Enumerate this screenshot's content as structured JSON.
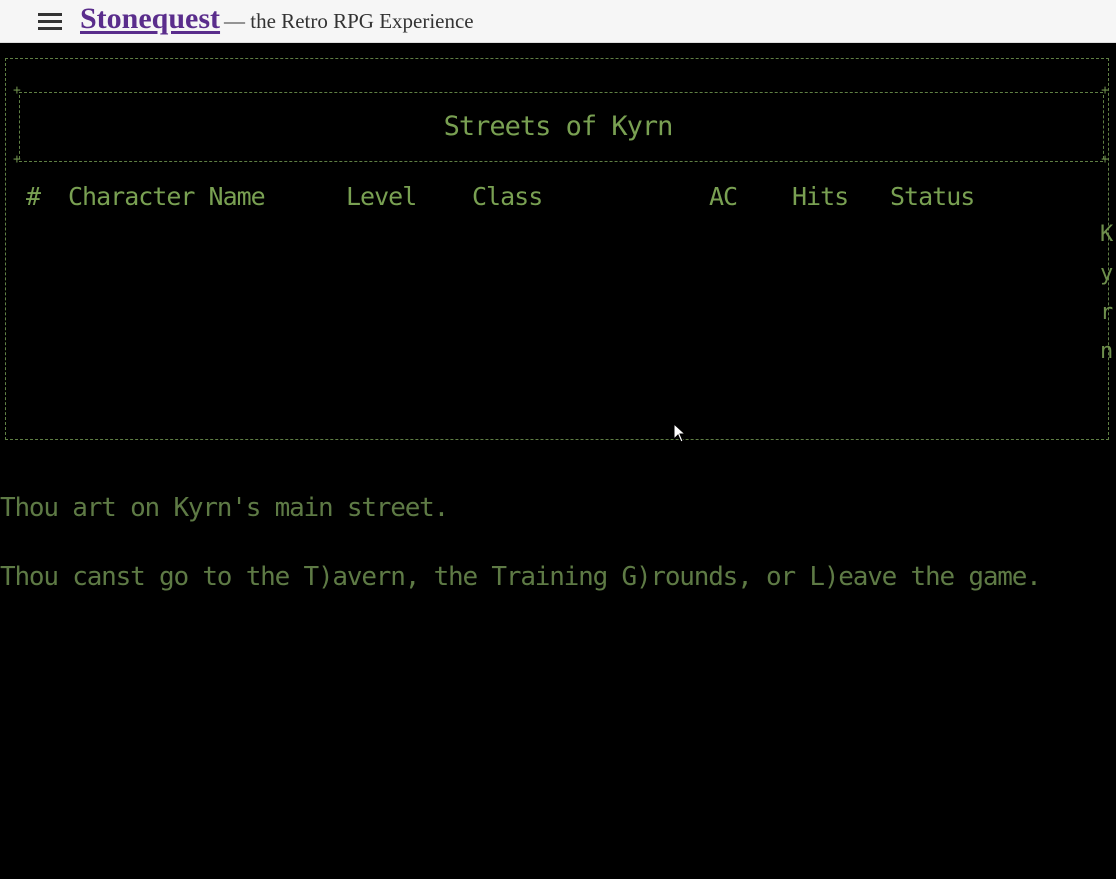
{
  "header": {
    "menu_icon": "hamburger-menu-icon",
    "brand_name": "Stonequest",
    "tagline": "— the Retro RPG Experience"
  },
  "terminal": {
    "title": "Streets of Kyrn",
    "columns": [
      "#",
      "Character Name",
      "Level",
      "Class",
      "AC",
      "Hits",
      "Status"
    ],
    "side_letters": [
      "K",
      "y",
      "r",
      "n"
    ],
    "messages": [
      "Thou art on Kyrn's main street.",
      "Thou canst go to the T)avern, the Training G)rounds, or L)eave the game."
    ]
  },
  "colors": {
    "terminal_bg": "#000000",
    "terminal_fg": "#79a052",
    "brand": "#5a2d8c",
    "topbar_bg": "#f6f6f6"
  }
}
